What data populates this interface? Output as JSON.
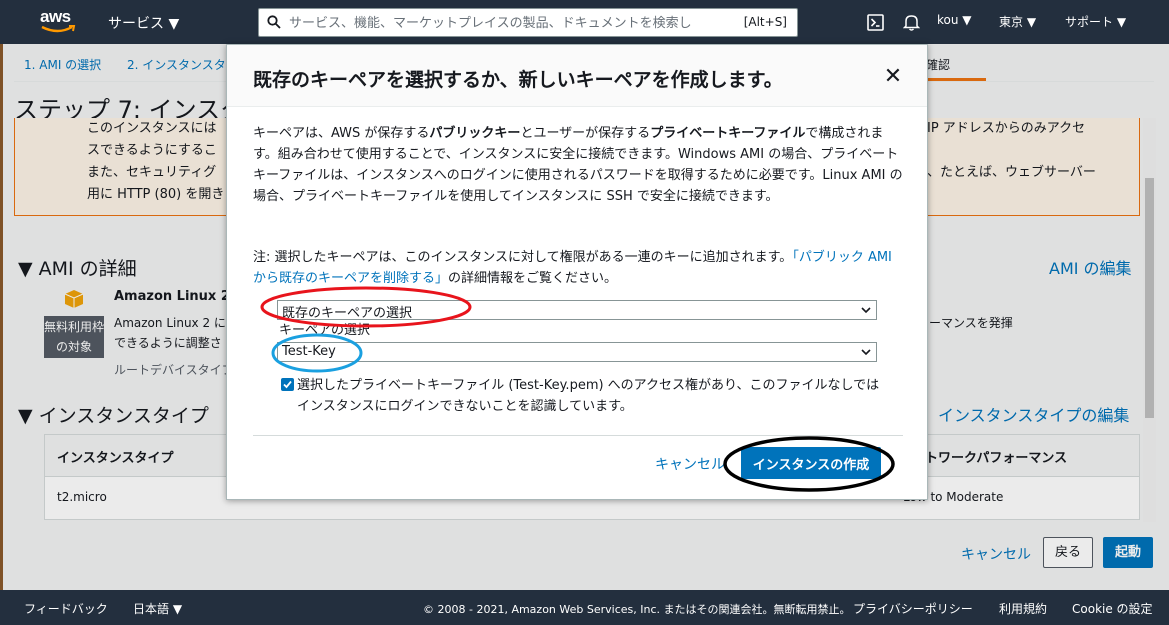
{
  "nav": {
    "logo": "aws",
    "services": "サービス ▼",
    "search_placeholder": "サービス、機能、マーケットプレイスの製品、ドキュメントを検索し",
    "search_shortcut": "[Alt+S]",
    "user": "kou ▼",
    "region": "東京 ▼",
    "support": "サポート ▼"
  },
  "steps": [
    "1. AMI の選択",
    "2. インスタンスタ",
    "確認"
  ],
  "page": {
    "title": "ステップ 7: インスタ",
    "warning": {
      "line1_left": "このインスタンスには",
      "line1_right": "IP アドレスからのみアクセ",
      "line2_left": "スできるようにするこ",
      "line3_left": "また、セキュリティグ",
      "line3_right": "、たとえば、ウェブサーバー",
      "line4_left": "用に HTTP (80) を開き"
    },
    "ami_section": {
      "title": "▼ AMI の詳細",
      "edit": "AMI の編集",
      "name": "Amazon Linux 2",
      "badge_line1": "無料利用枠",
      "badge_line2": "の対象",
      "desc_line1": "Amazon Linux 2 に",
      "desc_line2": "できるように調整さ",
      "desc_line3": "ルートデバイスタイプ",
      "desc_right": "ーマンスを発揮"
    },
    "instance_section": {
      "title": "▼ インスタンスタイプ",
      "edit": "インスタンスタイプの編集",
      "col_type": "インスタンスタイプ",
      "col_network": "トワークパフォーマンス",
      "row_type": "t2.micro",
      "row_network": "Low to Moderate"
    },
    "bottom_buttons": {
      "cancel": "キャンセル",
      "back": "戻る",
      "launch": "起動"
    }
  },
  "modal": {
    "title": "既存のキーペアを選択するか、新しいキーペアを作成します。",
    "close": "✕",
    "desc": {
      "p1": "キーペアは、AWS が保存する",
      "b1": "パブリックキー",
      "p2": "とユーザーが保存する",
      "b2": "プライベートキーファイル",
      "p3": "で構成されます。組み合わせて使用することで、インスタンスに安全に接続できます。Windows AMI の場合、プライベートキーファイルは、インスタンスへのログインに使用されるパスワードを取得するために必要です。Linux AMI の場合、プライベートキーファイルを使用してインスタンスに SSH で安全に接続できます。"
    },
    "note": {
      "p1": "注: 選択したキーペアは、このインスタンスに対して権限がある一連のキーに追加されます。",
      "link": "「パブリック AMI から既存のキーペアを削除する」",
      "p2": "の詳細情報をご覧ください。"
    },
    "select_mode": "既存のキーペアの選択",
    "select_label": "キーペアの選択",
    "select_key": "Test-Key",
    "ack": "選択したプライベートキーファイル (Test-Key.pem) へのアクセス権があり、このファイルなしではインスタンスにログインできないことを認識しています。",
    "ack_checked": true,
    "cancel": "キャンセル",
    "create": "インスタンスの作成"
  },
  "footer": {
    "feedback": "フィードバック",
    "language": "日本語 ▼",
    "copyright": "© 2008 - 2021, Amazon Web Services, Inc. またはその関連会社。無断転用禁止。",
    "privacy": "プライバシーポリシー",
    "terms": "利用規約",
    "cookies": "Cookie の設定"
  },
  "colors": {
    "nav_bg": "#232f3e",
    "link": "#0073bb",
    "warning_border": "#ec7211",
    "annotation_red": "#e8141c",
    "annotation_blue": "#1aa0e0",
    "annotation_black": "#000000"
  }
}
